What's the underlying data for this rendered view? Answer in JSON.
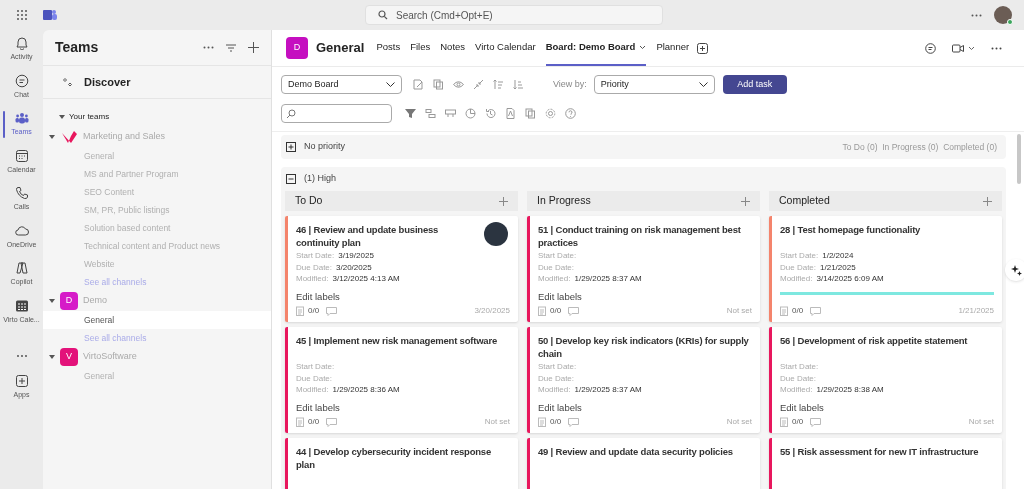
{
  "top_bar": {
    "search_placeholder": "Search (Cmd+Opt+E)"
  },
  "rail": [
    {
      "label": "Activity",
      "selected": false
    },
    {
      "label": "Chat",
      "selected": false
    },
    {
      "label": "Teams",
      "selected": true
    },
    {
      "label": "Calendar",
      "selected": false
    },
    {
      "label": "Calls",
      "selected": false
    },
    {
      "label": "OneDrive",
      "selected": false
    },
    {
      "label": "Copilot",
      "selected": false
    },
    {
      "label": "Virto Cale...",
      "selected": false
    },
    {
      "selected": false
    },
    {
      "label": "Apps",
      "selected": false
    }
  ],
  "teams_panel": {
    "title": "Teams",
    "discover": "Discover",
    "section": "Your teams",
    "teams": [
      {
        "name": "Marketing and Sales",
        "color": "#e8175d",
        "channels": [
          {
            "name": "General",
            "kind": "channel",
            "selected": false
          },
          {
            "name": "MS and Partner Program",
            "kind": "channel",
            "selected": false
          },
          {
            "name": "SEO Content",
            "kind": "channel",
            "selected": false
          },
          {
            "name": "SM, PR, Public listings",
            "kind": "channel",
            "selected": false
          },
          {
            "name": "Solution based content",
            "kind": "channel",
            "selected": false
          },
          {
            "name": "Technical content and Product news",
            "kind": "channel",
            "selected": false
          },
          {
            "name": "Website",
            "kind": "channel",
            "selected": false
          },
          {
            "name": "See all channels",
            "kind": "link",
            "selected": false
          }
        ]
      },
      {
        "name": "Demo",
        "avatar": "D",
        "color": "#d61bc8",
        "channels": [
          {
            "name": "General",
            "kind": "channel",
            "selected": true
          },
          {
            "name": "See all channels",
            "kind": "link",
            "selected": false
          }
        ]
      },
      {
        "name": "VirtoSoftware",
        "avatar": "V",
        "color": "#e3127a",
        "channels": [
          {
            "name": "General",
            "kind": "channel",
            "selected": false
          }
        ]
      }
    ]
  },
  "channel_header": {
    "avatar": "D",
    "title": "General",
    "tabs": [
      {
        "label": "Posts",
        "selected": false
      },
      {
        "label": "Files",
        "selected": false
      },
      {
        "label": "Notes",
        "selected": false
      },
      {
        "label": "Virto Calendar",
        "selected": false
      },
      {
        "label": "Board: Demo Board",
        "selected": true
      },
      {
        "label": "Planner",
        "selected": false
      }
    ]
  },
  "toolbar": {
    "board": "Demo Board",
    "view_by_label": "View by:",
    "view_by": "Priority",
    "add_task": "Add task"
  },
  "groups": [
    {
      "title": "No priority",
      "expanded": false,
      "summary": "To Do (0)  In Progress (0)  Completed (0)"
    },
    {
      "title": "(1) High",
      "expanded": true,
      "columns": [
        {
          "title": "To Do",
          "cards": [
            {
              "title": "46 | Review and update business continuity plan",
              "color": "#f4846c",
              "avatar": true,
              "fields": [
                {
                  "label": "Start Date:",
                  "value": "3/19/2025"
                },
                {
                  "label": "Due Date:",
                  "value": "3/20/2025"
                },
                {
                  "label": "Modified:",
                  "value": "3/12/2025 4:13 AM"
                }
              ],
              "edit_labels": "Edit labels",
              "checklist": "0/0",
              "date": "3/20/2025"
            },
            {
              "title": "45 | Implement new risk management software",
              "color": "#e8175d",
              "fields": [
                {
                  "label": "Start Date:"
                },
                {
                  "label": "Due Date:"
                },
                {
                  "label": "Modified:",
                  "value": "1/29/2025 8:36 AM"
                }
              ],
              "edit_labels": "Edit labels",
              "checklist": "0/0",
              "date": "Not set"
            },
            {
              "title": "44 | Develop cybersecurity incident response plan",
              "color": "#e8175d"
            }
          ]
        },
        {
          "title": "In Progress",
          "cards": [
            {
              "title": "51 | Conduct training on risk management best practices",
              "color": "#e8175d",
              "fields": [
                {
                  "label": "Start Date:"
                },
                {
                  "label": "Due Date:"
                },
                {
                  "label": "Modified:",
                  "value": "1/29/2025 8:37 AM"
                }
              ],
              "edit_labels": "Edit labels",
              "checklist": "0/0",
              "date": "Not set"
            },
            {
              "title": "50 | Develop key risk indicators (KRIs) for supply chain",
              "color": "#e8175d",
              "fields": [
                {
                  "label": "Start Date:"
                },
                {
                  "label": "Due Date:"
                },
                {
                  "label": "Modified:",
                  "value": "1/29/2025 8:37 AM"
                }
              ],
              "edit_labels": "Edit labels",
              "checklist": "0/0",
              "date": "Not set"
            },
            {
              "title": "49 | Review and update data security policies",
              "color": "#e8175d"
            }
          ]
        },
        {
          "title": "Completed",
          "cards": [
            {
              "title": "28 | Test homepage functionality",
              "color": "#f4846c",
              "fields": [
                {
                  "label": "Start Date:",
                  "value": "1/2/2024"
                },
                {
                  "label": "Due Date:",
                  "value": "1/21/2025"
                },
                {
                  "label": "Modified:",
                  "value": "3/14/2025 6:09 AM"
                }
              ],
              "level": 1,
              "checklist": "0/0",
              "date": "1/21/2025"
            },
            {
              "title": "56 | Development of risk appetite statement",
              "color": "#e8175d",
              "fields": [
                {
                  "label": "Start Date:"
                },
                {
                  "label": "Due Date:"
                },
                {
                  "label": "Modified:",
                  "value": "1/29/2025 8:38 AM"
                }
              ],
              "edit_labels": "Edit labels",
              "checklist": "0/0",
              "date": "Not set"
            },
            {
              "title": "55 | Risk assessment for new IT infrastructure",
              "color": "#e8175d"
            }
          ]
        }
      ]
    }
  ]
}
